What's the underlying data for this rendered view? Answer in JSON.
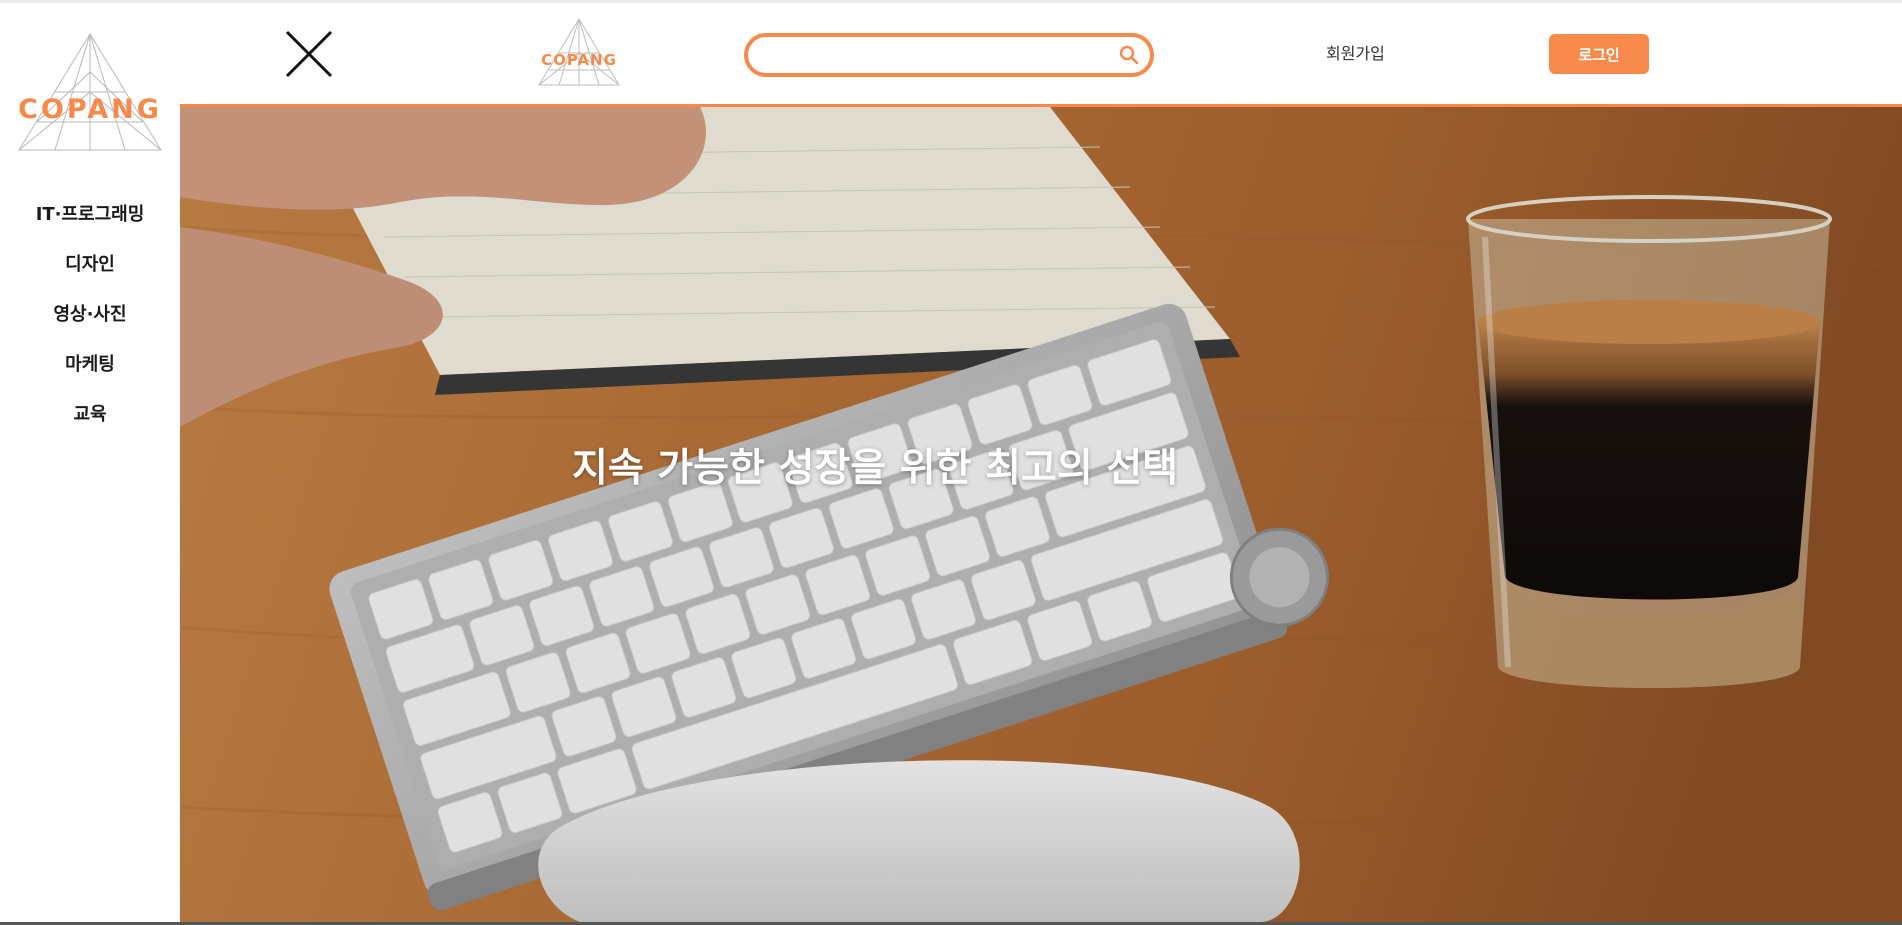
{
  "brand": {
    "name": "COPANG",
    "accent": "#f7894a"
  },
  "sidebar": {
    "items": [
      {
        "label": "IT·프로그래밍"
      },
      {
        "label": "디자인"
      },
      {
        "label": "영상·사진"
      },
      {
        "label": "마케팅"
      },
      {
        "label": "교육"
      }
    ]
  },
  "header": {
    "close_icon": "close-icon",
    "search": {
      "value": "",
      "placeholder": "",
      "icon": "search-icon"
    },
    "signup_label": "회원가입",
    "login_label": "로그인"
  },
  "hero": {
    "headline": "지속 가능한 성장을 위한 최고의 선택",
    "image": "keyboard-coffee-desk-photo"
  }
}
